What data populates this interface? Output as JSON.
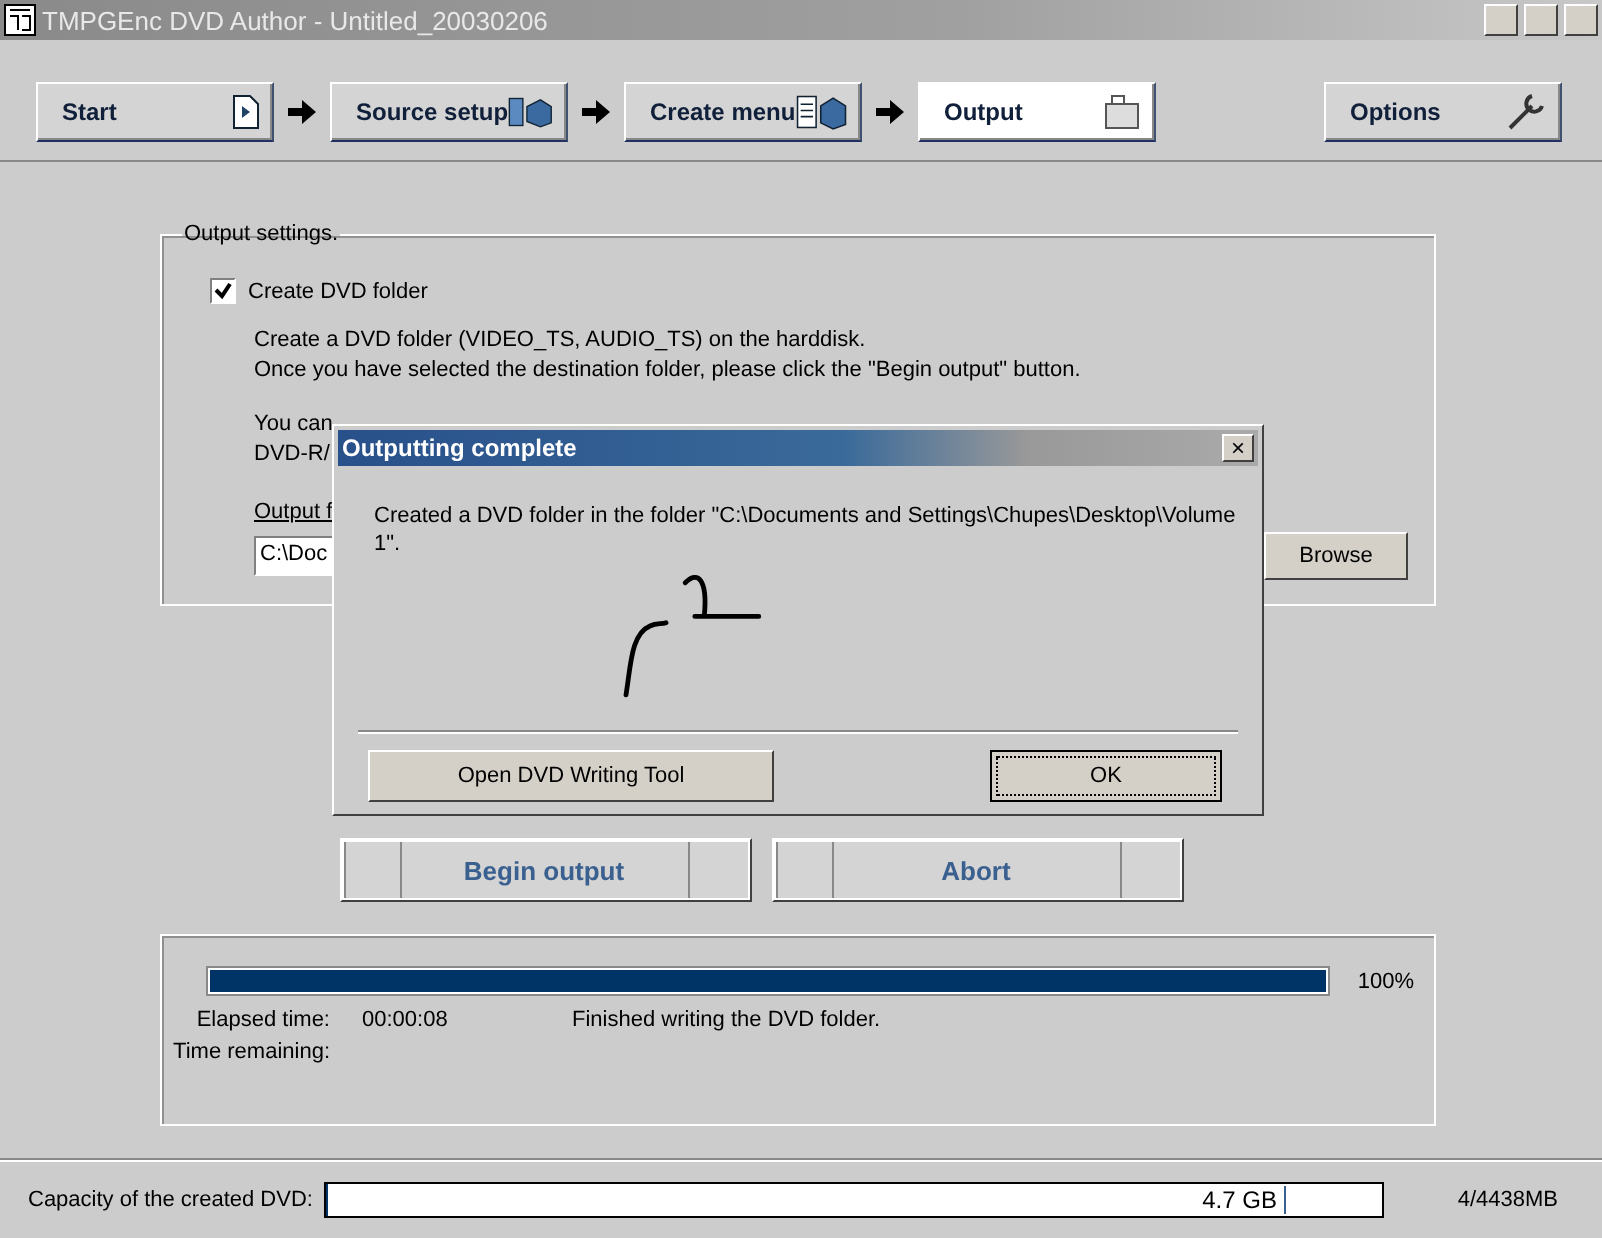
{
  "window": {
    "title": "TMPGEnc DVD Author - Untitled_20030206"
  },
  "steps": [
    {
      "label": "Start",
      "selected": false
    },
    {
      "label": "Source setup",
      "selected": false
    },
    {
      "label": "Create menu",
      "selected": false
    },
    {
      "label": "Output",
      "selected": true
    }
  ],
  "options_button": "Options",
  "output_settings": {
    "legend": "Output settings.",
    "create_folder": {
      "label": "Create DVD folder",
      "checked": true
    },
    "description": [
      "Create a DVD folder (VIDEO_TS, AUDIO_TS) on the harddisk.",
      "Once you have selected the destination folder, please click the \"Begin output\" button."
    ],
    "burn_note": [
      "You can",
      "DVD-R/"
    ],
    "folder_label": "Output f",
    "folder_value": "C:\\Doc",
    "browse": "Browse"
  },
  "actions": [
    "Begin output",
    "Abort"
  ],
  "progress": {
    "level": 1,
    "percent": "100%",
    "elapsed_label": "Elapsed time:",
    "elapsed": "00:00:08",
    "status": "Finished writing the DVD folder.",
    "remaining_label": "Time remaining:"
  },
  "capacity": {
    "label": "Capacity of the created DVD:",
    "level": 0.001,
    "marker": "4.7 GB",
    "usage": "4/4438MB"
  },
  "dialog": {
    "title": "Outputting complete",
    "close": "×",
    "message": "Created a DVD folder in the folder \"C:\\Documents and Settings\\Chupes\\Desktop\\Volume 1\".",
    "buttons": [
      {
        "label": "Open DVD Writing Tool",
        "default": false
      },
      {
        "label": "OK",
        "default": true
      }
    ]
  }
}
